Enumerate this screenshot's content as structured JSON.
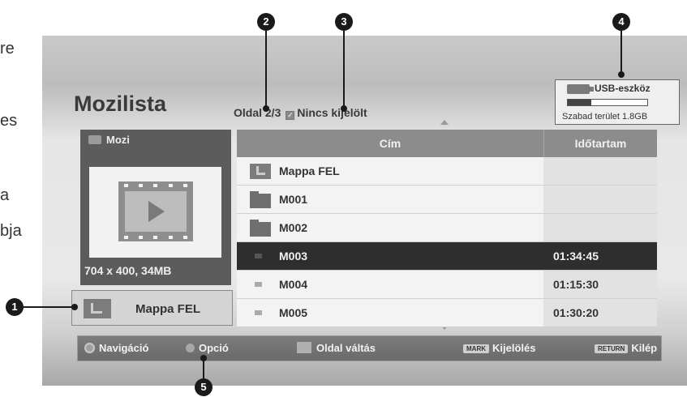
{
  "side_text": [
    "re",
    "es",
    "a",
    "bja"
  ],
  "header": {
    "title": "Mozilista",
    "page_info": "Oldal 2/3",
    "selection_status": "Nincs kijelölt"
  },
  "usb": {
    "label": "USB-eszköz",
    "free_space": "Szabad terület 1.8GB",
    "usage_fraction": 0.3
  },
  "preview": {
    "header": "Mozi",
    "info": "704 x 400, 34MB"
  },
  "folder_up_button": {
    "label": "Mappa FEL"
  },
  "list": {
    "columns": {
      "title": "Cím",
      "duration": "Időtartam"
    },
    "rows": [
      {
        "name": "Mappa FEL",
        "duration": "",
        "icon": "folder-up-icon"
      },
      {
        "name": "M001",
        "duration": "",
        "icon": "folder-icon"
      },
      {
        "name": "M002",
        "duration": "",
        "icon": "folder-icon"
      },
      {
        "name": "M003",
        "duration": "01:34:45",
        "icon": "movie-file-icon",
        "selected": true
      },
      {
        "name": "M004",
        "duration": "01:15:30",
        "icon": "movie-file-icon"
      },
      {
        "name": "M005",
        "duration": "01:30:20",
        "icon": "movie-file-icon"
      }
    ]
  },
  "footer": {
    "navigation": "Navigáció",
    "option": "Opció",
    "page_change": "Oldal váltás",
    "mark_key": "MARK",
    "mark": "Kijelölés",
    "return_key": "RETURN",
    "exit": "Kilép"
  },
  "callouts": [
    "1",
    "2",
    "3",
    "4",
    "5"
  ],
  "colors": {
    "selected_row": "#2e2e2e",
    "header_row": "#8c8c8c",
    "footer_bar": "#727272"
  }
}
